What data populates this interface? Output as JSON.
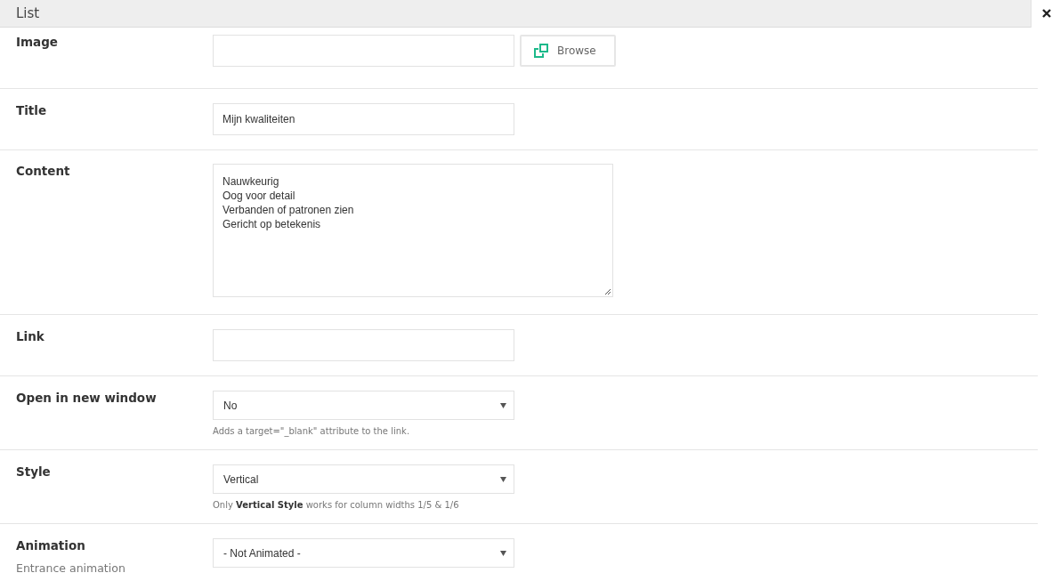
{
  "window": {
    "title": "List"
  },
  "fields": [
    {
      "kind": "image",
      "label": "Image",
      "button": "Browse"
    },
    {
      "kind": "text",
      "label": "Title",
      "value": "Mijn kwaliteiten"
    },
    {
      "kind": "textarea",
      "label": "Content",
      "lines": [
        "Nauwkeurig",
        "Oog voor detail",
        "Verbanden of patronen zien",
        "Gericht op betekenis"
      ]
    },
    {
      "kind": "text",
      "label": "Link"
    },
    {
      "kind": "select",
      "label": "Open in new window",
      "value": "No",
      "help": "Adds a target=\"_blank\" attribute to the link."
    },
    {
      "kind": "select",
      "label": "Style",
      "value": "Vertical",
      "help": "Only **Vertical Style** works for column widths 1/5 & 1/6"
    },
    {
      "kind": "select",
      "label": "Animation",
      "sublabel": "Entrance animation",
      "value": "- Not Animated -"
    }
  ]
}
